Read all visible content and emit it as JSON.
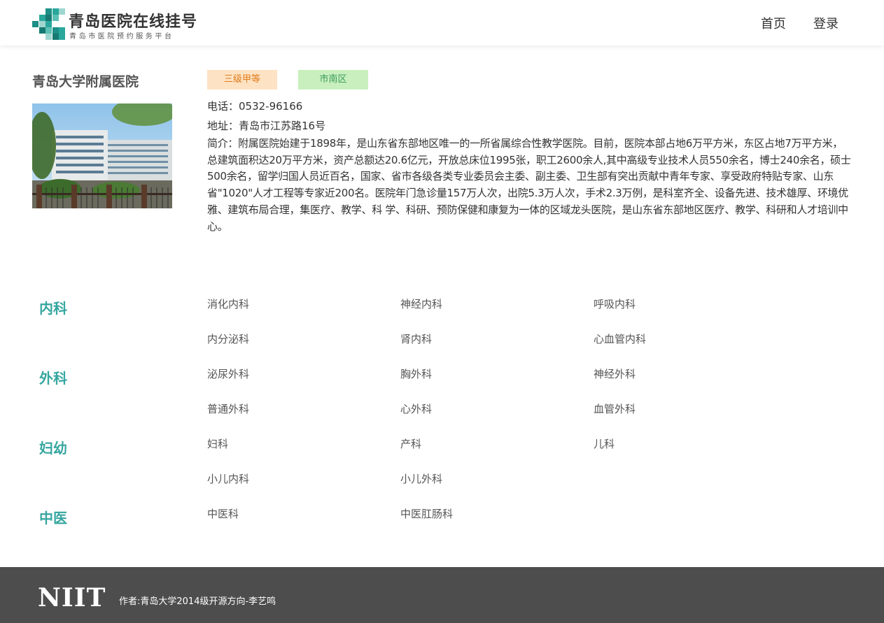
{
  "header": {
    "logo_title": "青岛医院在线挂号",
    "logo_subtitle": "青岛市医院预约服务平台",
    "nav": [
      "首页",
      "登录"
    ]
  },
  "hospital": {
    "name": "青岛大学附属医院",
    "level_tag": "三级甲等",
    "district_tag": "市南区",
    "phone": "电话：0532-96166",
    "address": "地址：青岛市江苏路16号",
    "intro": "简介：附属医院始建于1898年，是山东省东部地区唯一的一所省属综合性教学医院。目前，医院本部占地6万平方米，东区占地7万平方米，总建筑面积达20万平方米，资产总额达20.6亿元，开放总床位1995张，职工2600余人,其中高级专业技术人员550余名，博士240余名，硕士500余名，留学归国人员近百名，国家、省市各级各类专业委员会主委、副主委、卫生部有突出贡献中青年专家、享受政府特贴专家、山东省\"1020\"人才工程等专家近200名。医院年门急诊量157万人次，出院5.3万人次，手术2.3万例，是科室齐全、设备先进、技术雄厚、环境优雅、建筑布局合理，集医疗、教学、科 学、科研、预防保健和康复为一体的区域龙头医院，是山东省东部地区医疗、教学、科研和人才培训中心。"
  },
  "departments": [
    {
      "name": "内科",
      "items": [
        "消化内科",
        "神经内科",
        "呼吸内科",
        "内分泌科",
        "肾内科",
        "心血管内科"
      ]
    },
    {
      "name": "外科",
      "items": [
        "泌尿外科",
        "胸外科",
        "神经外科",
        "普通外科",
        "心外科",
        "血管外科"
      ]
    },
    {
      "name": "妇幼",
      "items": [
        "妇科",
        "产科",
        "儿科",
        "小儿内科",
        "小儿外科"
      ]
    },
    {
      "name": "中医",
      "items": [
        "中医科",
        "中医肛肠科"
      ]
    }
  ],
  "footer": {
    "logo": "NIIT",
    "credit": "作者:青岛大学2014级开源方向-李艺鸣"
  },
  "colors": {
    "accent": "#36a6a0",
    "footer_bg": "#4d4d4d",
    "level_tag_bg": "#fde3c3",
    "district_tag_bg": "#c9efbf"
  }
}
